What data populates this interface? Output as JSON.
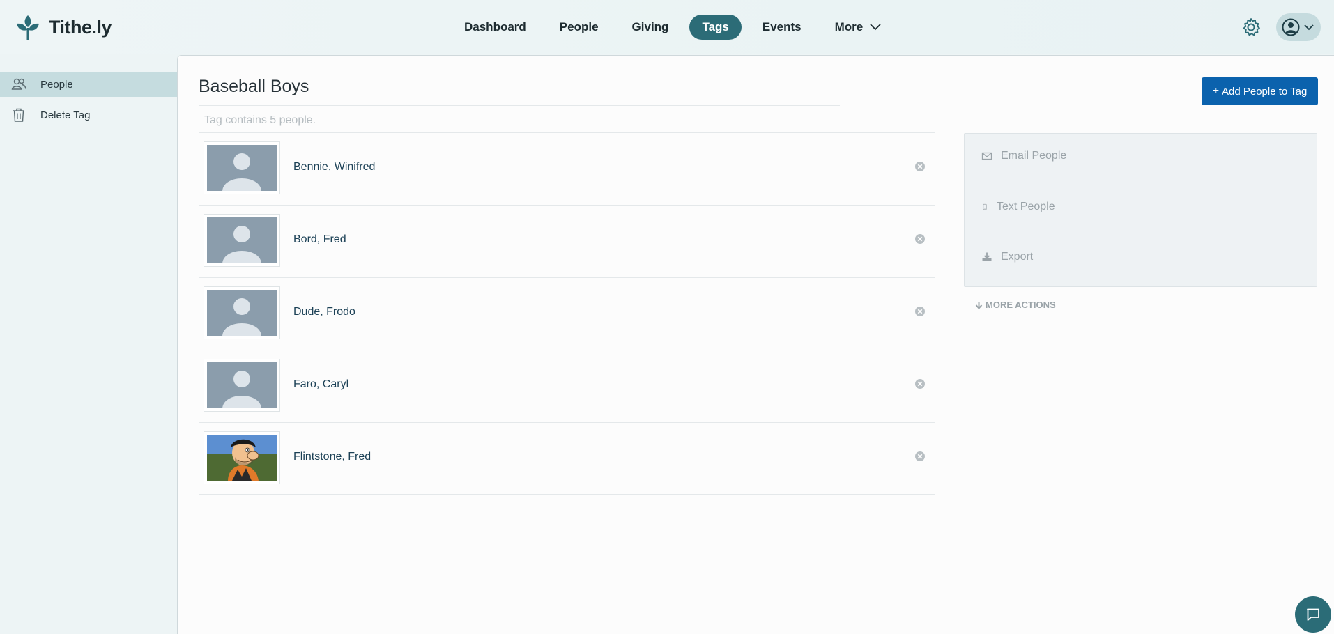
{
  "app": {
    "brand": "Tithe.ly"
  },
  "nav": {
    "items": [
      {
        "label": "Dashboard"
      },
      {
        "label": "People"
      },
      {
        "label": "Giving"
      },
      {
        "label": "Tags",
        "active": true
      },
      {
        "label": "Events"
      },
      {
        "label": "More"
      }
    ]
  },
  "sidebar": {
    "items": [
      {
        "label": "People",
        "icon": "people-icon",
        "active": true
      },
      {
        "label": "Delete Tag",
        "icon": "trash-icon"
      }
    ]
  },
  "page": {
    "title": "Baseball Boys",
    "subtitle": "Tag contains 5 people.",
    "add_button": "Add People to Tag"
  },
  "people": [
    {
      "name": "Bennie, Winifred",
      "avatar": "placeholder"
    },
    {
      "name": "Bord, Fred",
      "avatar": "placeholder"
    },
    {
      "name": "Dude, Frodo",
      "avatar": "placeholder"
    },
    {
      "name": "Faro, Caryl",
      "avatar": "placeholder"
    },
    {
      "name": "Flintstone, Fred",
      "avatar": "photo"
    }
  ],
  "actions": {
    "email": "Email People",
    "text": "Text People",
    "export": "Export",
    "more": "MORE ACTIONS"
  },
  "colors": {
    "accent": "#2c6c77",
    "primary_button": "#0b62ad",
    "link": "#1c4156"
  }
}
